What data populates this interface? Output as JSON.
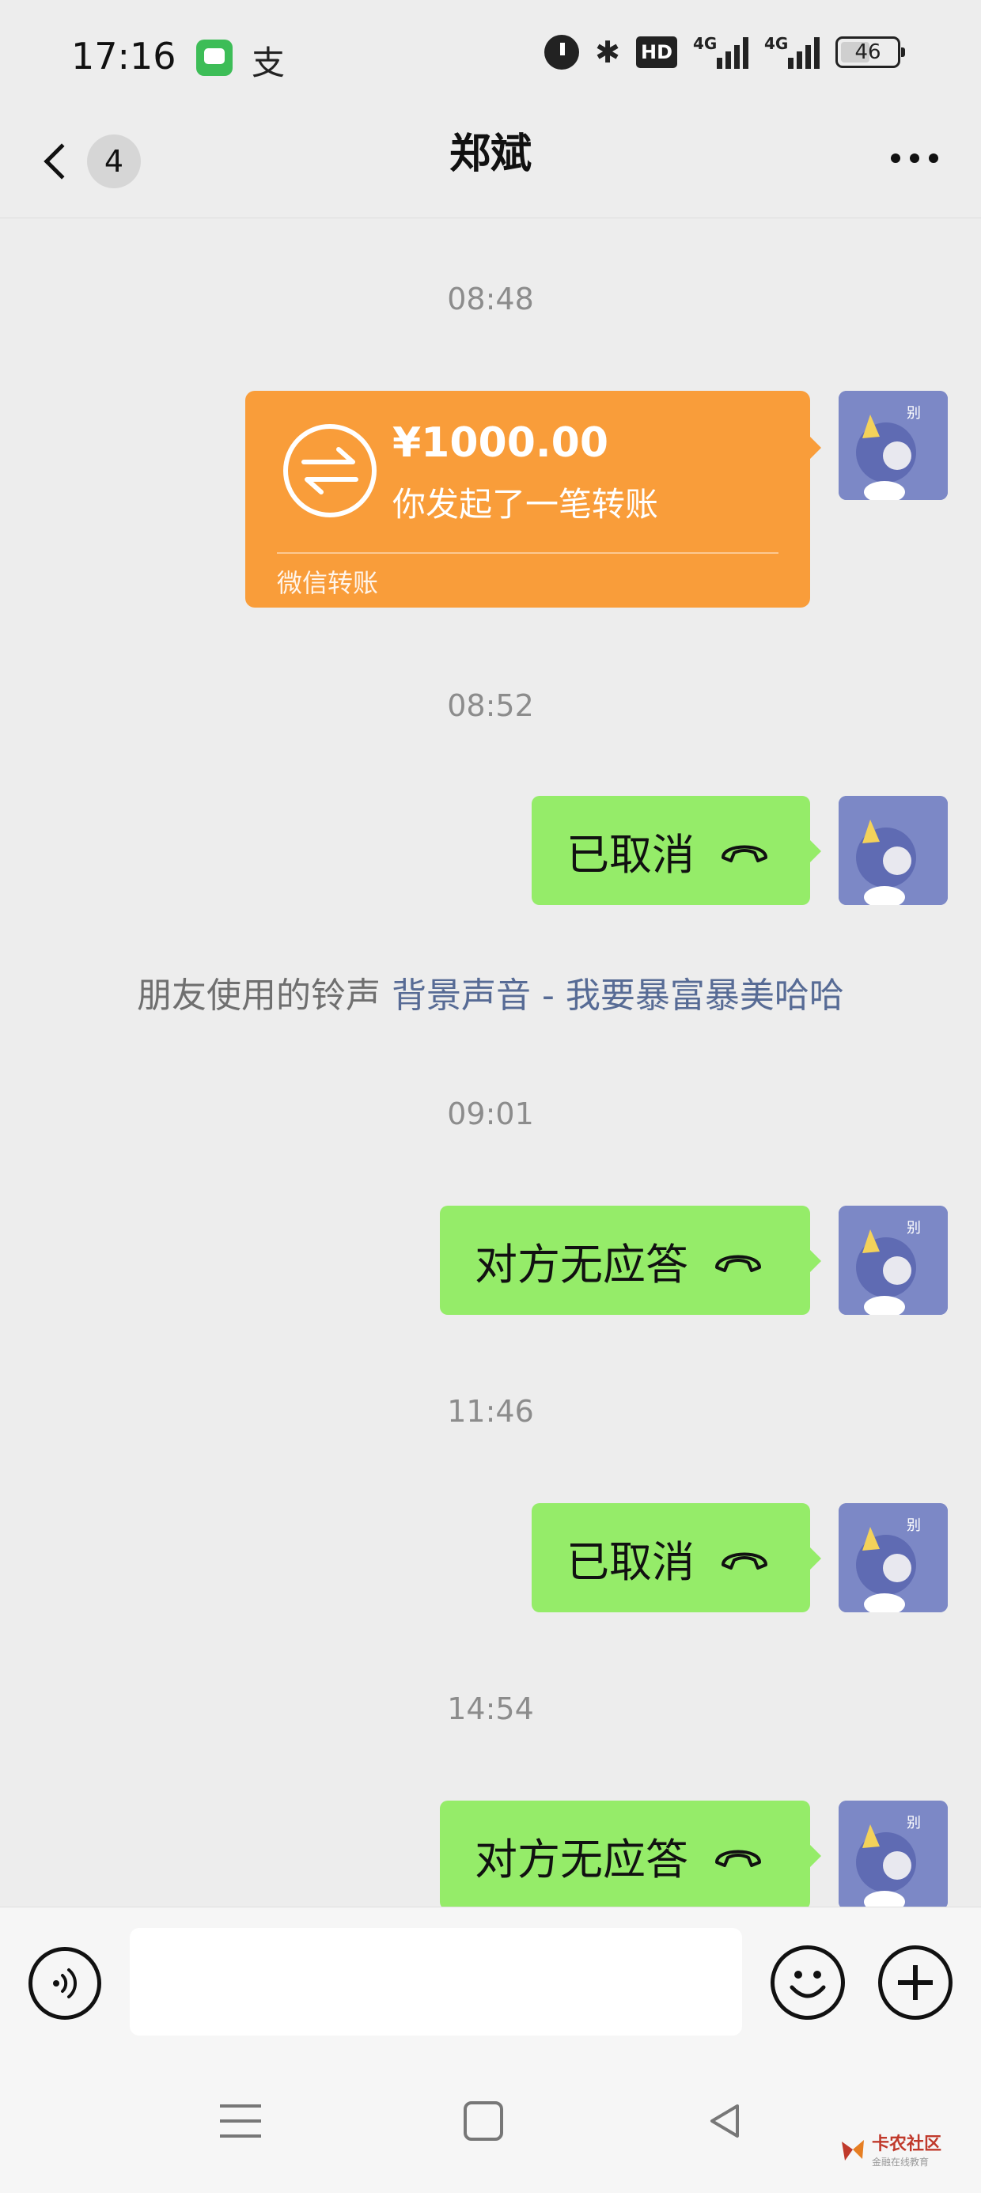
{
  "status_bar": {
    "time": "17:16",
    "app_icon_2": "支",
    "network_1": "4G",
    "network_2": "4G",
    "hd_label": "HD",
    "battery": "46"
  },
  "nav": {
    "unread_count": "4",
    "title": "郑斌"
  },
  "messages": [
    {
      "type": "timestamp",
      "text": "08:48"
    },
    {
      "type": "transfer",
      "amount": "¥1000.00",
      "desc": "你发起了一笔转账",
      "label": "微信转账",
      "color": "#f99d3a"
    },
    {
      "type": "timestamp",
      "text": "08:52"
    },
    {
      "type": "call",
      "text": "已取消"
    },
    {
      "type": "system",
      "prefix": "朋友使用的铃声 ",
      "link": "背景声音 - 我要暴富暴美哈哈"
    },
    {
      "type": "timestamp",
      "text": "09:01"
    },
    {
      "type": "call",
      "text": "对方无应答"
    },
    {
      "type": "timestamp",
      "text": "11:46"
    },
    {
      "type": "call",
      "text": "已取消"
    },
    {
      "type": "timestamp",
      "text": "14:54"
    },
    {
      "type": "call",
      "text": "对方无应答"
    }
  ],
  "input_bar": {
    "value": "",
    "icons": [
      "voice-icon",
      "emoji-icon",
      "plus-icon"
    ]
  },
  "watermark": {
    "main": "卡农社区",
    "sub": "金融在线教育"
  },
  "colors": {
    "bubble_green": "#95ec69",
    "transfer_orange": "#f99d3a",
    "link_blue": "#576b95",
    "background": "#ededed"
  }
}
